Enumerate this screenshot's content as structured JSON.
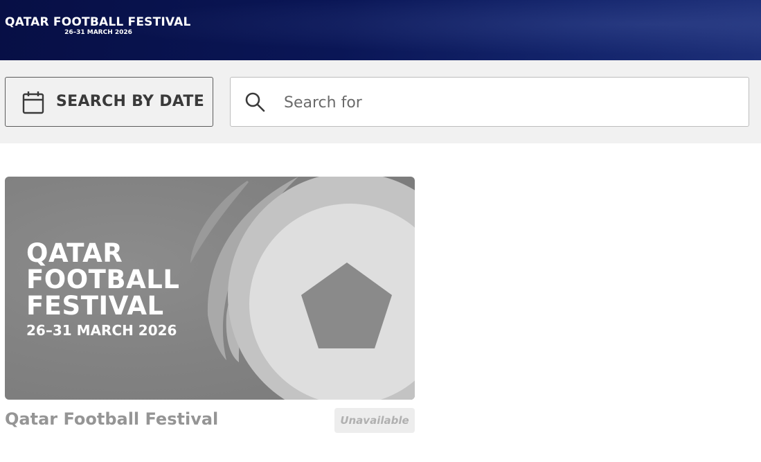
{
  "header": {
    "logo_title": "QATAR FOOTBALL FESTIVAL",
    "logo_dates": "26–31 MARCH 2026",
    "background_color": "#0a1656"
  },
  "toolbar": {
    "date_button_label": "SEARCH BY DATE",
    "date_button_icon": "calendar-icon",
    "search_placeholder": "Search for",
    "search_value": "",
    "search_icon": "search-icon"
  },
  "events": [
    {
      "title": "Qatar Football Festival",
      "status": "Unavailable",
      "image_lines": [
        "QATAR",
        "FOOTBALL",
        "FESTIVAL",
        "26–31 MARCH 2026"
      ]
    }
  ]
}
